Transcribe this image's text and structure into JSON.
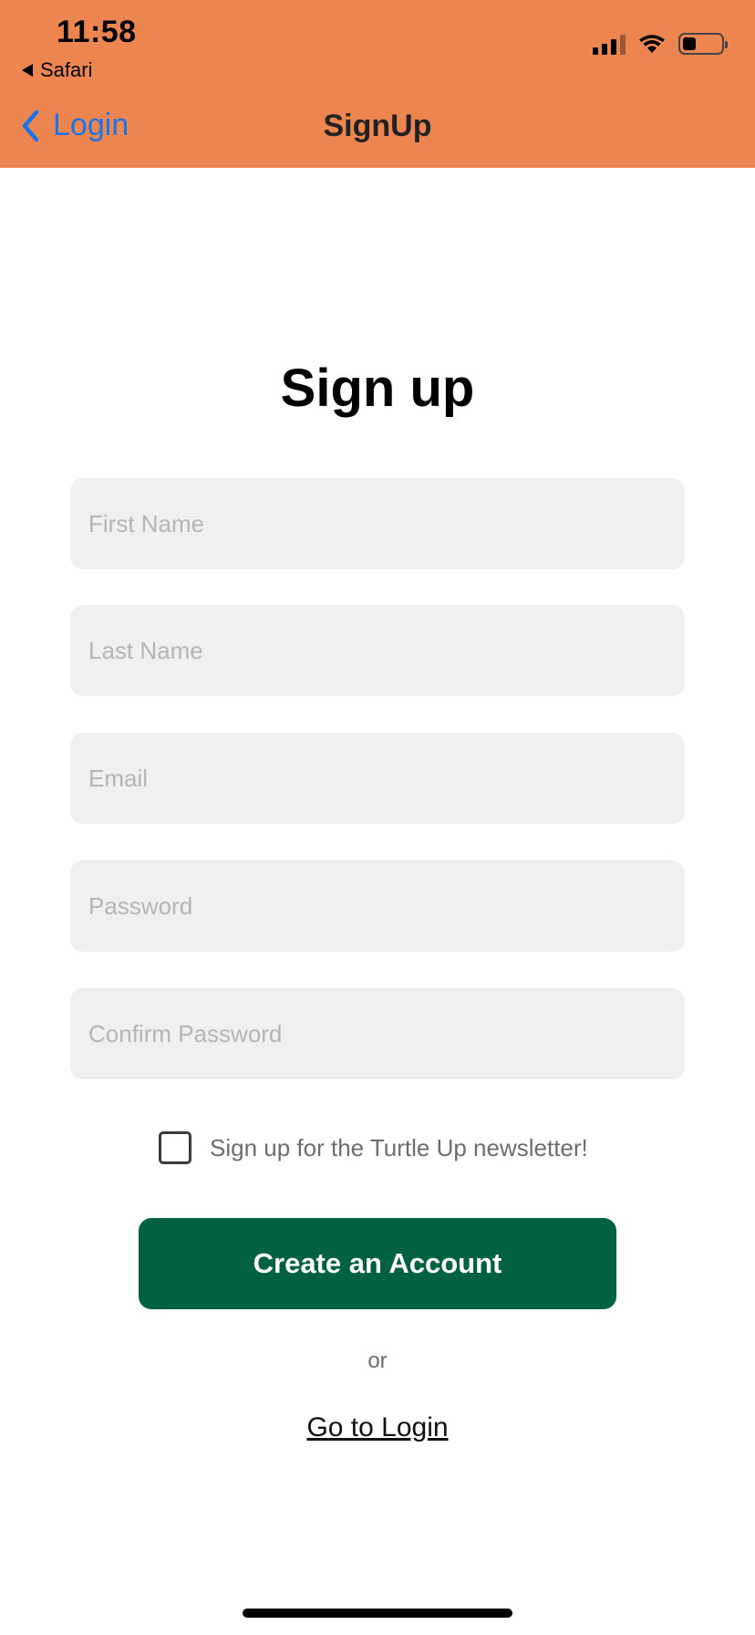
{
  "status_bar": {
    "time": "11:58",
    "back_app_label": "Safari"
  },
  "nav": {
    "back_label": "Login",
    "title": "SignUp"
  },
  "page": {
    "title": "Sign up"
  },
  "form": {
    "first_name_placeholder": "First Name",
    "last_name_placeholder": "Last Name",
    "email_placeholder": "Email",
    "password_placeholder": "Password",
    "confirm_password_placeholder": "Confirm Password",
    "newsletter_label": "Sign up for the Turtle Up newsletter!",
    "newsletter_checked": false,
    "submit_label": "Create an Account",
    "or_label": "or",
    "login_link_label": "Go to Login"
  },
  "colors": {
    "header_bg": "#ED8551",
    "link_blue": "#1A73E8",
    "button_green": "#026140",
    "field_bg": "#F0F0F0"
  },
  "icons": [
    "back-triangle-icon",
    "signal-icon",
    "wifi-icon",
    "battery-icon",
    "chevron-left-icon"
  ]
}
